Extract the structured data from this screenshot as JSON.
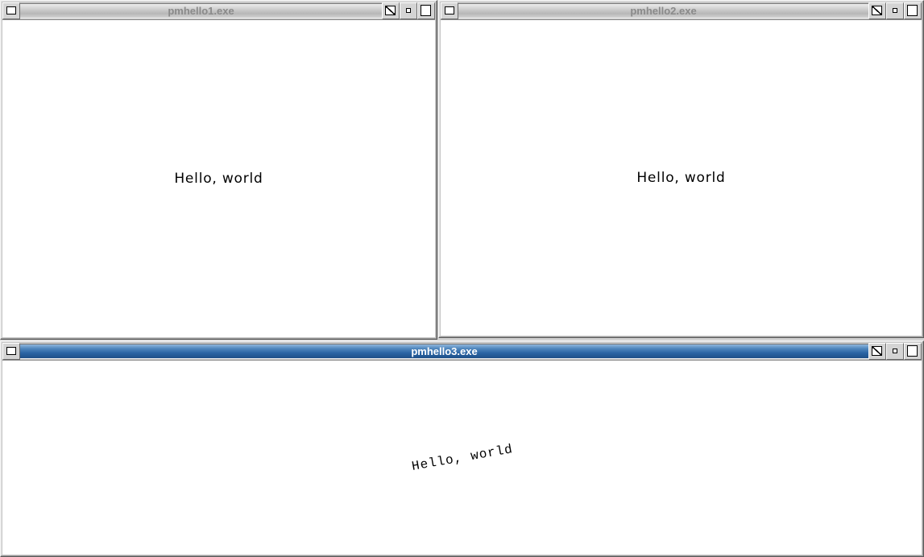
{
  "windows": [
    {
      "title": "pmhello1.exe",
      "active": false,
      "client_text": "Hello, world",
      "text_rotation_degrees": 0
    },
    {
      "title": "pmhello2.exe",
      "active": false,
      "client_text": "Hello, world",
      "text_rotation_degrees": 0
    },
    {
      "title": "pmhello3.exe",
      "active": true,
      "client_text": "Hello, world",
      "text_rotation_degrees": -10
    }
  ],
  "colors": {
    "active_title": "#2a64a4",
    "inactive_title": "#c9c9c9",
    "client_background": "#ffffff",
    "frame": "#c6c6c6"
  },
  "icons": {
    "system_menu": "system-menu-icon",
    "window_menu": "window-menu-icon",
    "minimize": "minimize-icon",
    "maximize": "maximize-icon"
  }
}
